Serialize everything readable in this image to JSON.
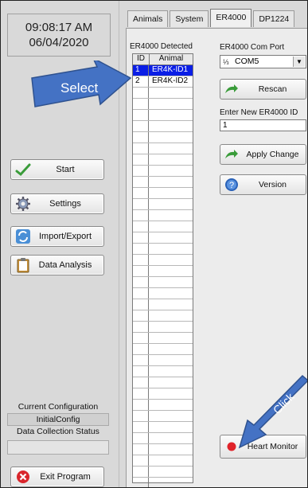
{
  "clock": {
    "time": "09:08:17 AM",
    "date": "06/04/2020"
  },
  "sidebar": {
    "buttons": [
      {
        "label": "Start",
        "icon": "check-icon"
      },
      {
        "label": "Settings",
        "icon": "gear-icon"
      },
      {
        "label": "Import/Export",
        "icon": "sync-icon"
      },
      {
        "label": "Data Analysis",
        "icon": "clipboard-icon"
      }
    ],
    "current_configuration_label": "Current Configuration",
    "current_configuration_value": "InitialConfig",
    "data_collection_status_label": "Data Collection Status",
    "data_collection_status_value": "",
    "exit_label": "Exit Program"
  },
  "tabs": [
    {
      "label": "Animals",
      "active": false
    },
    {
      "label": "System",
      "active": false
    },
    {
      "label": "ER4000",
      "active": true
    },
    {
      "label": "DP1224",
      "active": false
    }
  ],
  "er4000": {
    "detected_label": "ER4000 Detected",
    "table": {
      "headers": [
        "ID",
        "Animal"
      ],
      "rows": [
        {
          "id": "1",
          "animal": "ER4K-ID1",
          "selected": true
        },
        {
          "id": "2",
          "animal": "ER4K-ID2",
          "selected": false
        }
      ]
    },
    "com_port_label": "ER4000 Com Port",
    "com_port_value": "COM5",
    "rescan_label": "Rescan",
    "new_id_label": "Enter New ER4000 ID",
    "new_id_value": "1",
    "apply_label": "Apply Change",
    "version_label": "Version",
    "heart_monitor_label": "Heart Monitor"
  },
  "annotations": {
    "select": "Select",
    "click": "Click"
  },
  "colors": {
    "selection": "#0a1ee6",
    "callout": "#4472c4",
    "exit_icon": "#d9262c",
    "green_arrow": "#3a9c3a"
  }
}
